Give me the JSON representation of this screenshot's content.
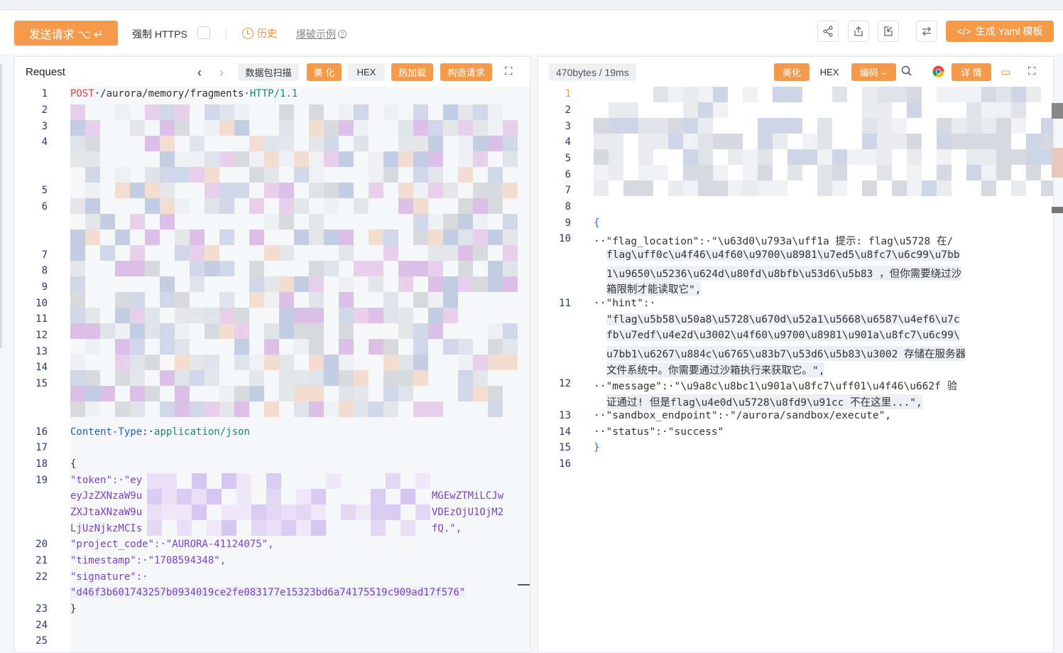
{
  "toolbar": {
    "send_label": "发送请求 ⌥ ↵",
    "https_label": "强制 HTTPS",
    "history_label": "历史",
    "example_label": "爆破示例",
    "yaml_label": "生成 Yaml 模板",
    "yaml_icon": "</>",
    "icons": [
      "share-icon",
      "export-icon",
      "import-icon",
      "swap-icon"
    ]
  },
  "request": {
    "title": "Request",
    "buttons": {
      "scan": "数据包扫描",
      "beautify": "美 化",
      "hex": "HEX",
      "hot_load": "热加载",
      "build": "构造请求"
    },
    "lines": [
      {
        "n": "1",
        "method": "POST",
        "path": "·/aurora/memory/fragments·",
        "proto": "HTTP/1.1"
      },
      {
        "n": "16",
        "key": "Content-Type",
        "sep": ":·",
        "val": "application/json"
      },
      {
        "n": "18",
        "text": "{"
      },
      {
        "n": "19",
        "text": "\"token\":·\"ey"
      },
      {
        "n": "19b",
        "text": "eyJzZXNzaW9u",
        "tail": "MGEwZTMiLCJw"
      },
      {
        "n": "19c",
        "text": "ZXJtaXNzaW9u",
        "tail": "VDEzOjU1OjM2"
      },
      {
        "n": "19d",
        "text": "LjUzNjkzMCIs",
        "tail": "fQ.\","
      },
      {
        "n": "20",
        "text": "\"project_code\":·\"AURORA-41124075\","
      },
      {
        "n": "21",
        "text": "\"timestamp\":·\"1708594348\","
      },
      {
        "n": "22",
        "text": "\"signature\":·"
      },
      {
        "n": "22b",
        "text": "\"d46f3b601743257b0934019ce2fe083177e15323bd6a74175519c909ad17f576\""
      },
      {
        "n": "23",
        "text": "}"
      }
    ],
    "line_numbers": [
      "1",
      "2",
      "3",
      "4",
      "5",
      "6",
      "7",
      "8",
      "9",
      "10",
      "11",
      "12",
      "13",
      "14",
      "15",
      "16",
      "17",
      "18",
      "19",
      "20",
      "21",
      "22",
      "23",
      "24",
      "25"
    ]
  },
  "response": {
    "stat": "470bytes / 19ms",
    "buttons": {
      "beautify": "美化",
      "hex": "HEX",
      "encode": "编码",
      "detail": "详 情"
    },
    "line_numbers": [
      "1",
      "2",
      "3",
      "4",
      "5",
      "6",
      "7",
      "8",
      "9",
      "10",
      "11",
      "12",
      "13",
      "14",
      "15",
      "16"
    ],
    "json_lines": [
      "{",
      "··\"flag_location\":·\"\\u63d0\\u793a\\uff1a 提示: flag\\u5728 在/",
      "flag\\uff0c\\u4f46\\u4f60\\u9700\\u8981\\u7ed5\\u8fc7\\u6c99\\u7bb",
      "1\\u9650\\u5236\\u624d\\u80fd\\u8bfb\\u53d6\\u5b83 ，但你需要绕过沙",
      "箱限制才能读取它\",",
      "··\"hint\":·",
      "\"flag\\u5b58\\u50a8\\u5728\\u670d\\u52a1\\u5668\\u6587\\u4ef6\\u7c",
      "fb\\u7edf\\u4e2d\\u3002\\u4f60\\u9700\\u8981\\u901a\\u8fc7\\u6c99\\",
      "u7bb1\\u6267\\u884c\\u6765\\u83b7\\u53d6\\u5b83\\u3002 存储在服务器",
      "文件系统中。你需要通过沙箱执行来获取它。\",",
      "··\"message\":·\"\\u9a8c\\u8bc1\\u901a\\u8fc7\\uff01\\u4f46\\u662f 验",
      "证通过! 但是flag\\u4e0d\\u5728\\u8fd9\\u91cc 不在这里...\",",
      "··\"sandbox_endpoint\":·\"/aurora/sandbox/execute\",",
      "··\"status\":·\"success\"",
      "}"
    ]
  },
  "colors": {
    "accent": "#f59a4a",
    "purple": "#7a40c8",
    "green": "#1a8a6a",
    "blue": "#1f5fbf"
  }
}
